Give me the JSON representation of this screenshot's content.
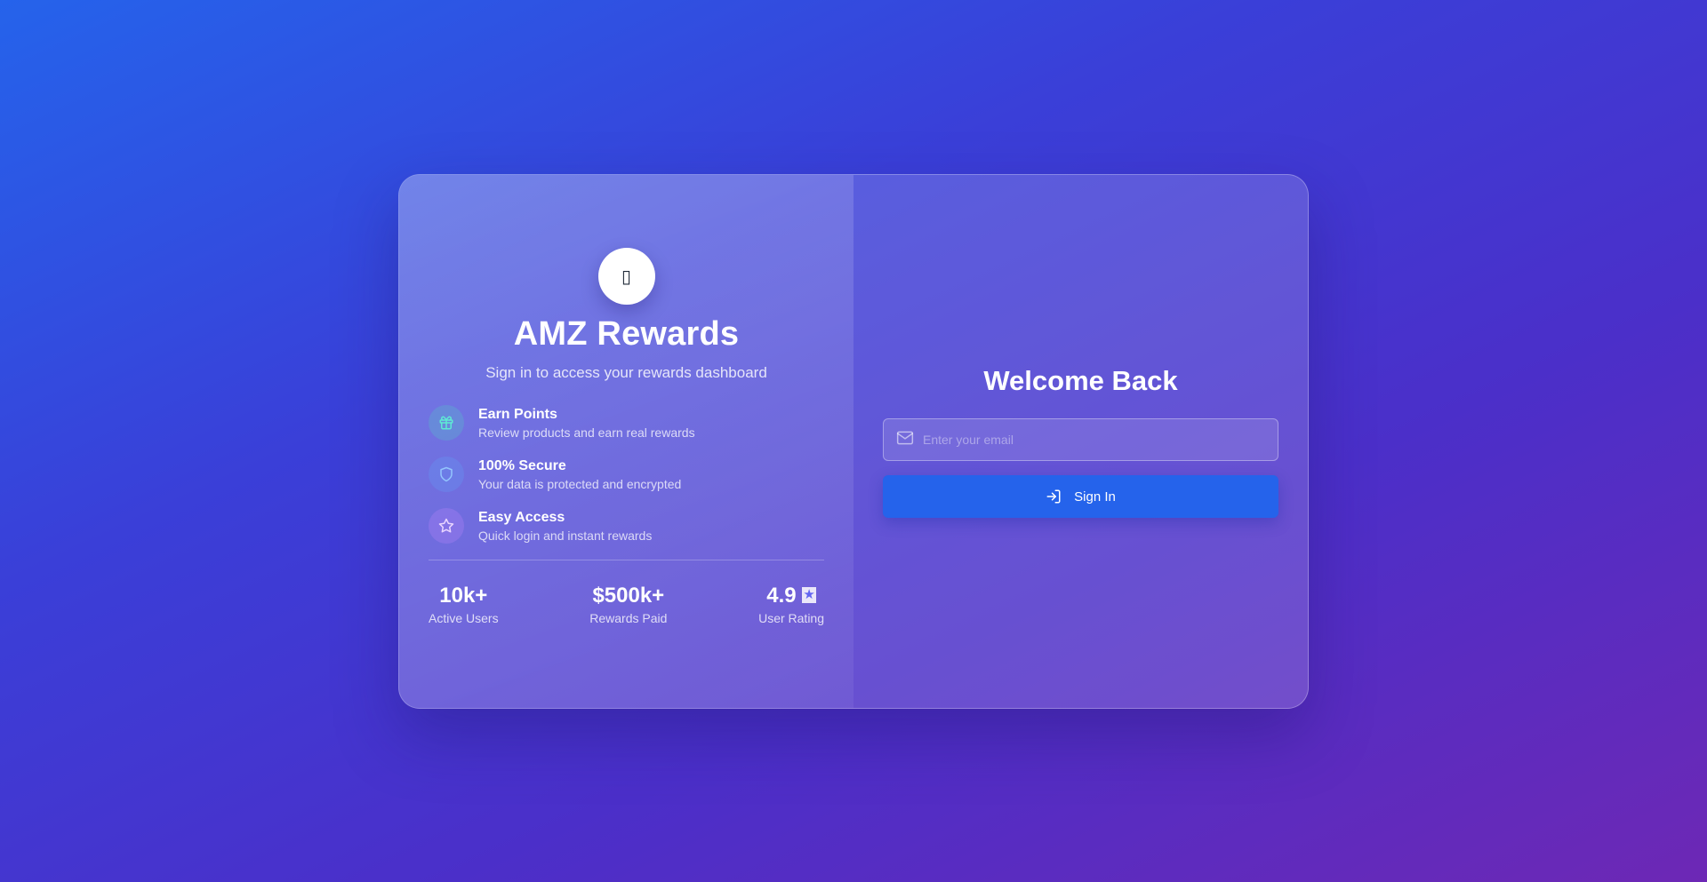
{
  "brand": {
    "logo_glyph": "▯",
    "name": "AMZ Rewards",
    "tagline": "Sign in to access your rewards dashboard"
  },
  "features": [
    {
      "icon": "gift-icon",
      "title": "Earn Points",
      "desc": "Review products and earn real rewards",
      "color": "#5eead4"
    },
    {
      "icon": "shield-icon",
      "title": "100% Secure",
      "desc": "Your data is protected and encrypted",
      "color": "#93c5fd"
    },
    {
      "icon": "star-icon",
      "title": "Easy Access",
      "desc": "Quick login and instant rewards",
      "color": "#e9d5ff"
    }
  ],
  "stats": [
    {
      "value": "10k+",
      "label": "Active Users"
    },
    {
      "value": "$500k+",
      "label": "Rewards Paid"
    },
    {
      "value": "4.9",
      "suffix": "★",
      "label": "User Rating"
    }
  ],
  "login": {
    "heading": "Welcome Back",
    "email_placeholder": "Enter your email",
    "email_value": "",
    "submit_label": "Sign In"
  },
  "colors": {
    "accent": "#2563eb",
    "bg_start": "#2563eb",
    "bg_end": "#6d28b5"
  }
}
